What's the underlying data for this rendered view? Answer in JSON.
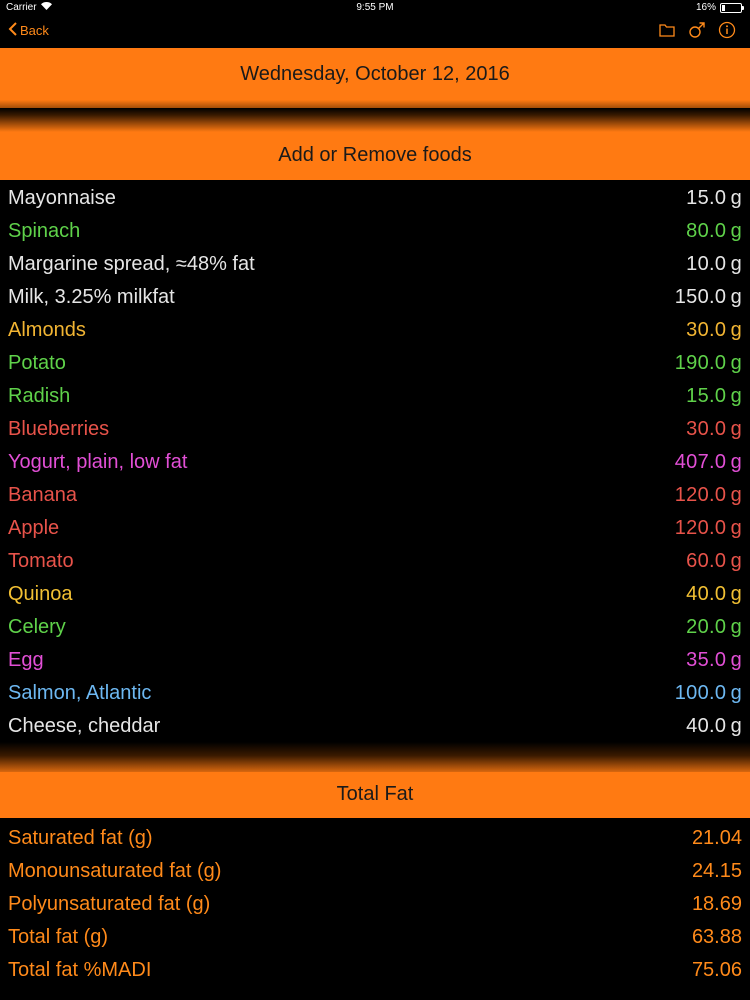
{
  "status": {
    "carrier": "Carrier",
    "time": "9:55 PM",
    "battery": "16%",
    "battery_level": 0.16
  },
  "nav": {
    "back_label": "Back"
  },
  "date_header": "Wednesday, October 12, 2016",
  "add_remove_label": "Add or Remove foods",
  "foods": [
    {
      "name": "Mayonnaise",
      "amount": "15.0 g",
      "color": "#e6e6e6"
    },
    {
      "name": "Spinach",
      "amount": "80.0 g",
      "color": "#5fd24a"
    },
    {
      "name": "Margarine spread, ≈48% fat",
      "amount": "10.0 g",
      "color": "#e6e6e6"
    },
    {
      "name": "Milk, 3.25% milkfat",
      "amount": "150.0 g",
      "color": "#e6e6e6"
    },
    {
      "name": "Almonds",
      "amount": "30.0 g",
      "color": "#f2b533"
    },
    {
      "name": "Potato",
      "amount": "190.0 g",
      "color": "#5fd24a"
    },
    {
      "name": "Radish",
      "amount": "15.0 g",
      "color": "#5fd24a"
    },
    {
      "name": "Blueberries",
      "amount": "30.0 g",
      "color": "#e8534a"
    },
    {
      "name": "Yogurt, plain, low fat",
      "amount": "407.0 g",
      "color": "#e24fd6"
    },
    {
      "name": "Banana",
      "amount": "120.0 g",
      "color": "#e8534a"
    },
    {
      "name": "Apple",
      "amount": "120.0 g",
      "color": "#e8534a"
    },
    {
      "name": "Tomato",
      "amount": "60.0 g",
      "color": "#e8534a"
    },
    {
      "name": "Quinoa",
      "amount": "40.0 g",
      "color": "#f2c033"
    },
    {
      "name": "Celery",
      "amount": "20.0 g",
      "color": "#5fd24a"
    },
    {
      "name": "Egg",
      "amount": "35.0 g",
      "color": "#e24fd6"
    },
    {
      "name": "Salmon, Atlantic",
      "amount": "100.0 g",
      "color": "#6db8f2"
    },
    {
      "name": "Cheese, cheddar",
      "amount": "40.0 g",
      "color": "#e6e6e6"
    }
  ],
  "total_fat_header": "Total Fat",
  "fats": [
    {
      "label": "Saturated fat (g)",
      "value": "21.04"
    },
    {
      "label": "Monounsaturated fat (g)",
      "value": "24.15"
    },
    {
      "label": "Polyunsaturated fat (g)",
      "value": "18.69"
    },
    {
      "label": "Total fat (g)",
      "value": "63.88"
    },
    {
      "label": "Total fat %MADI",
      "value": "75.06"
    }
  ],
  "colors": {
    "accent": "#ff7a12",
    "fat_text": "#ff8a1a"
  },
  "icons": [
    "wifi-icon",
    "back-chevron-icon",
    "folder-icon",
    "male-symbol-icon",
    "info-icon"
  ]
}
